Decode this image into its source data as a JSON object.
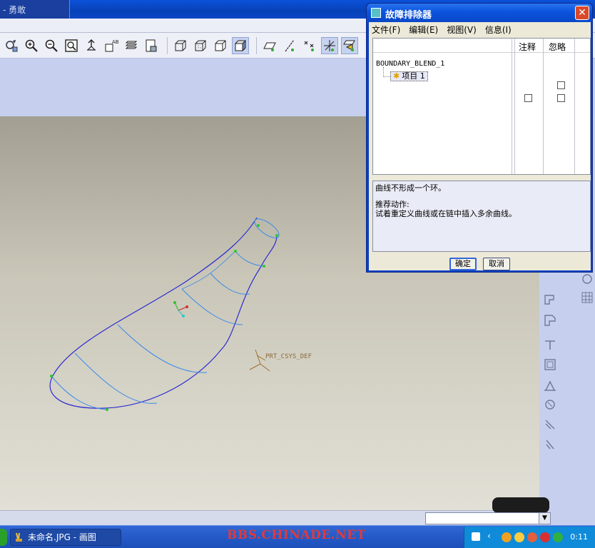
{
  "app": {
    "title_fragment": "- 勇敢"
  },
  "viewport": {
    "csys_label": "PRT_CSYS_DEF"
  },
  "toolbar": {
    "icons": [
      "repaint-icon",
      "zoom-in-icon",
      "zoom-out-icon",
      "zoom-fit-icon",
      "spin-center-icon",
      "annotation-display-icon",
      "layers-icon",
      "saved-views-icon",
      "wireframe-icon",
      "hidden-line-icon",
      "no-hidden-icon",
      "shading-icon",
      "datum-planes-icon",
      "datum-axes-icon",
      "datum-points-icon",
      "csys-icon",
      "csys-selected-icon"
    ]
  },
  "dialog": {
    "title": "故障排除器",
    "close_glyph": "✕",
    "menu": {
      "file": "文件(F)",
      "edit": "编辑(E)",
      "view": "视图(V)",
      "info": "信息(I)"
    },
    "columns": {
      "note": "注释",
      "ignore": "忽略"
    },
    "tree": {
      "root": "BOUNDARY_BLEND_1",
      "child": "项目 1"
    },
    "message": {
      "line1": "曲线不形成一个环。",
      "heading": "推荐动作:",
      "line2": "试着重定义曲线或在链中插入多余曲线。"
    },
    "buttons": {
      "ok": "确定",
      "cancel": "取消"
    }
  },
  "taskbar": {
    "task_label": "未命名.JPG - 画图",
    "watermark": "BBS.CHINADE.NET",
    "clock": "0:11"
  }
}
